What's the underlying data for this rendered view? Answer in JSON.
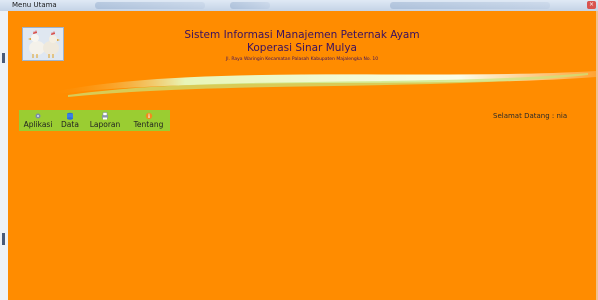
{
  "window": {
    "title": "Menu Utama",
    "close_glyph": "×"
  },
  "header": {
    "title": "Sistem Informasi Manajemen Peternak Ayam",
    "subtitle": "Koperasi Sinar Mulya",
    "address": "Jl. Raya Waringin Kecamatan Palasah Kabupaten Majalengka No. 10"
  },
  "menu": {
    "items": [
      {
        "label": "Aplikasi",
        "icon": "gear-app-icon"
      },
      {
        "label": "Data",
        "icon": "database-icon"
      },
      {
        "label": "Laporan",
        "icon": "report-printer-icon"
      },
      {
        "label": "Tentang",
        "icon": "info-icon"
      }
    ]
  },
  "welcome": {
    "text": "Selamat Datang : nia"
  },
  "colors": {
    "background": "#ff8c00",
    "menubar": "#9acd32",
    "title_text": "#3a1060",
    "swoosh": "#e8f5b8"
  }
}
